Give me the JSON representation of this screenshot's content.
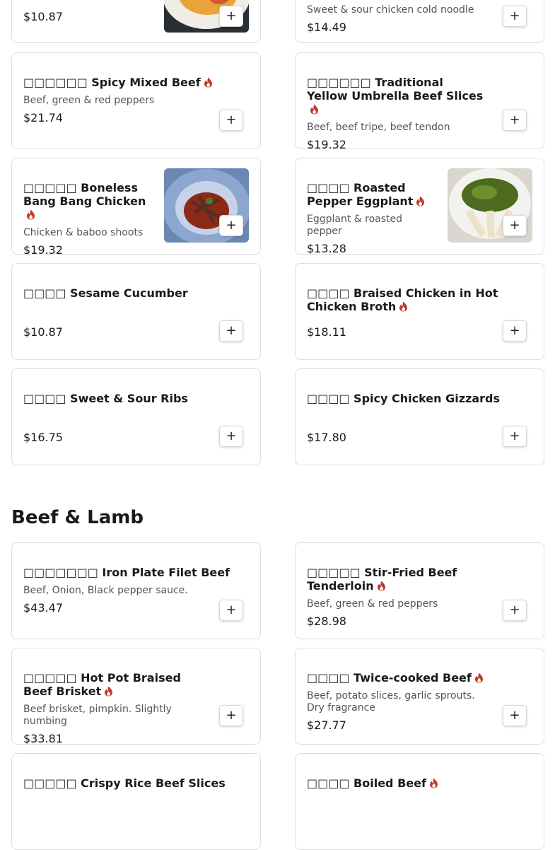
{
  "colors": {
    "flame": "#c0392b",
    "border": "#dedede"
  },
  "icons": {
    "spicy": "flame-icon",
    "add": "plus-icon"
  },
  "top_partial": {
    "left": {
      "price": "$10.87",
      "add_label": "+",
      "image": "dish-photo"
    },
    "right": {
      "description": "Sweet & sour chicken cold noodle",
      "price": "$14.49",
      "add_label": "+"
    }
  },
  "items": [
    {
      "name": "□□□□□□ Spicy Mixed Beef",
      "spicy": true,
      "description": "Beef, green & red peppers",
      "price": "$21.74",
      "add_label": "+"
    },
    {
      "name": "□□□□□□ Traditional Yellow Umbrella Beef Slices",
      "spicy": true,
      "description": "Beef, beef tripe, beef tendon",
      "price": "$19.32",
      "add_label": "+"
    },
    {
      "name": "□□□□□ Boneless Bang Bang Chicken",
      "spicy": true,
      "description": "Chicken & baboo shoots",
      "price": "$19.32",
      "add_label": "+",
      "image": "dish-photo"
    },
    {
      "name": "□□□□ Roasted Pepper Eggplant",
      "spicy": true,
      "description": "Eggplant & roasted pepper",
      "price": "$13.28",
      "add_label": "+",
      "image": "dish-photo"
    },
    {
      "name": "□□□□ Sesame Cucumber",
      "spicy": false,
      "description": "",
      "price": "$10.87",
      "add_label": "+"
    },
    {
      "name": "□□□□ Braised Chicken in Hot Chicken Broth",
      "spicy": true,
      "description": "",
      "price": "$18.11",
      "add_label": "+"
    },
    {
      "name": "□□□□ Sweet & Sour Ribs",
      "spicy": false,
      "description": "",
      "price": "$16.75",
      "add_label": "+"
    },
    {
      "name": "□□□□ Spicy Chicken Gizzards",
      "spicy": false,
      "description": "",
      "price": "$17.80",
      "add_label": "+"
    }
  ],
  "section": {
    "title": "Beef & Lamb",
    "items": [
      {
        "name": "□□□□□□□ Iron Plate Filet Beef",
        "spicy": false,
        "description": "Beef, Onion, Black pepper sauce.",
        "price": "$43.47",
        "add_label": "+"
      },
      {
        "name": "□□□□□ Stir-Fried Beef Tenderloin",
        "spicy": true,
        "description": "Beef, green & red peppers",
        "price": "$28.98",
        "add_label": "+"
      },
      {
        "name": "□□□□□ Hot Pot Braised Beef Brisket",
        "spicy": true,
        "description": "Beef brisket, pimpkin. Slightly numbing",
        "price": "$33.81",
        "add_label": "+"
      },
      {
        "name": "□□□□ Twice-cooked Beef",
        "spicy": true,
        "description": "Beef, potato slices, garlic sprouts. Dry fragrance",
        "price": "$27.77",
        "add_label": "+"
      },
      {
        "name": "□□□□□ Crispy Rice Beef Slices",
        "spicy": false
      },
      {
        "name": "□□□□ Boiled Beef",
        "spicy": true
      }
    ]
  }
}
